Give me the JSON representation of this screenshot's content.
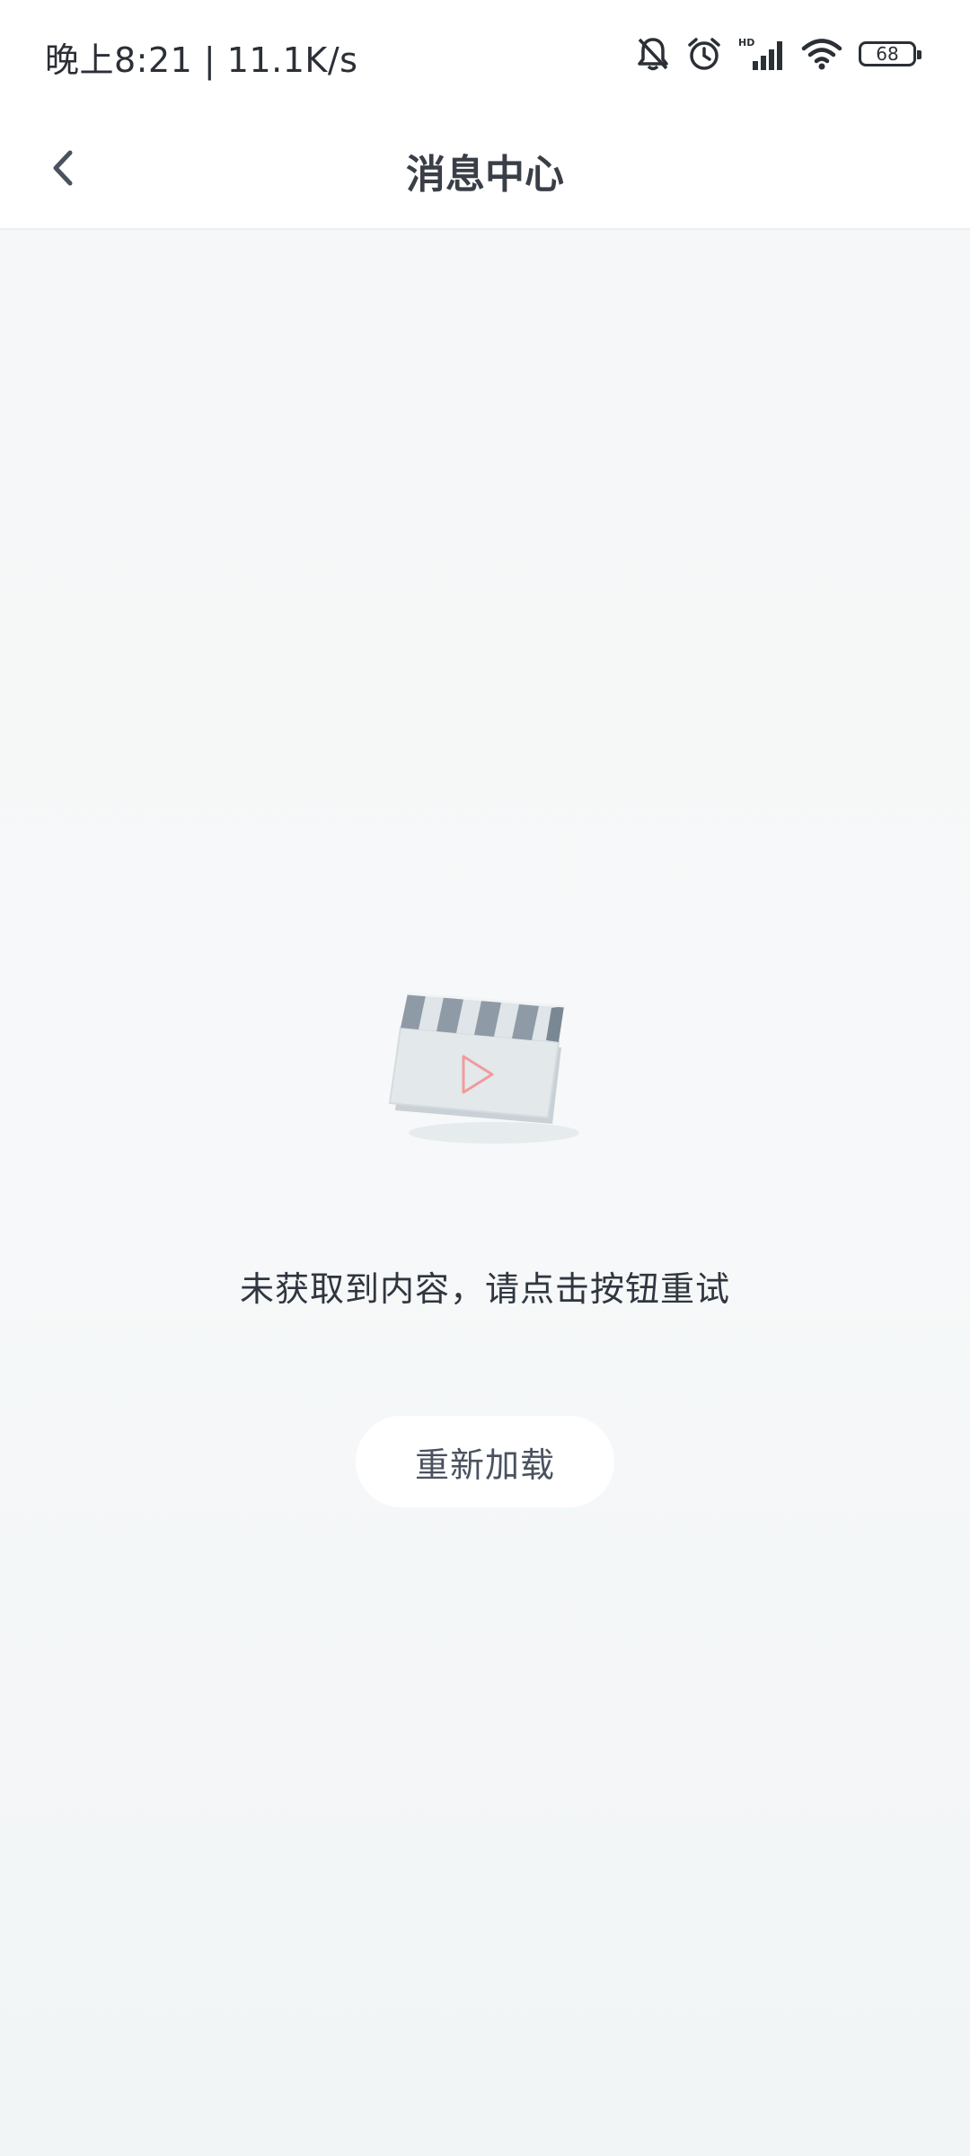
{
  "status_bar": {
    "time_speed": "晚上8:21 | 11.1K/s",
    "battery": "68",
    "icons": [
      "bell-off-icon",
      "alarm-icon",
      "hd-signal-icon",
      "wifi-icon",
      "battery-icon"
    ]
  },
  "header": {
    "back_icon": "chevron-left-icon",
    "title": "消息中心"
  },
  "empty_state": {
    "illustration": "video-clapperboard-icon",
    "message": "未获取到内容，请点击按钮重试",
    "reload_label": "重新加载"
  },
  "colors": {
    "background": "#f5f7f8",
    "text": "#2f3640",
    "button_bg": "#ffffff",
    "play_accent": "#f19b9b"
  }
}
